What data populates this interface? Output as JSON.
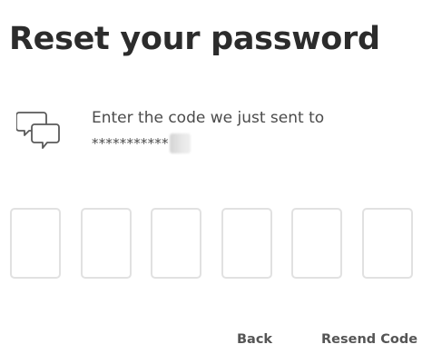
{
  "page": {
    "title": "Reset your password"
  },
  "message": {
    "line1": "Enter the code we just sent to",
    "masked_contact": "***********"
  },
  "code_inputs": {
    "count": 6,
    "values": [
      "",
      "",
      "",
      "",
      "",
      ""
    ]
  },
  "actions": {
    "back_label": "Back",
    "resend_label": "Resend Code"
  },
  "icons": {
    "message": "chat-bubbles-icon"
  },
  "colors": {
    "text_primary": "#2c2c2c",
    "text_secondary": "#4b4b4b",
    "box_border": "#e1e1e1",
    "link": "#555555"
  }
}
